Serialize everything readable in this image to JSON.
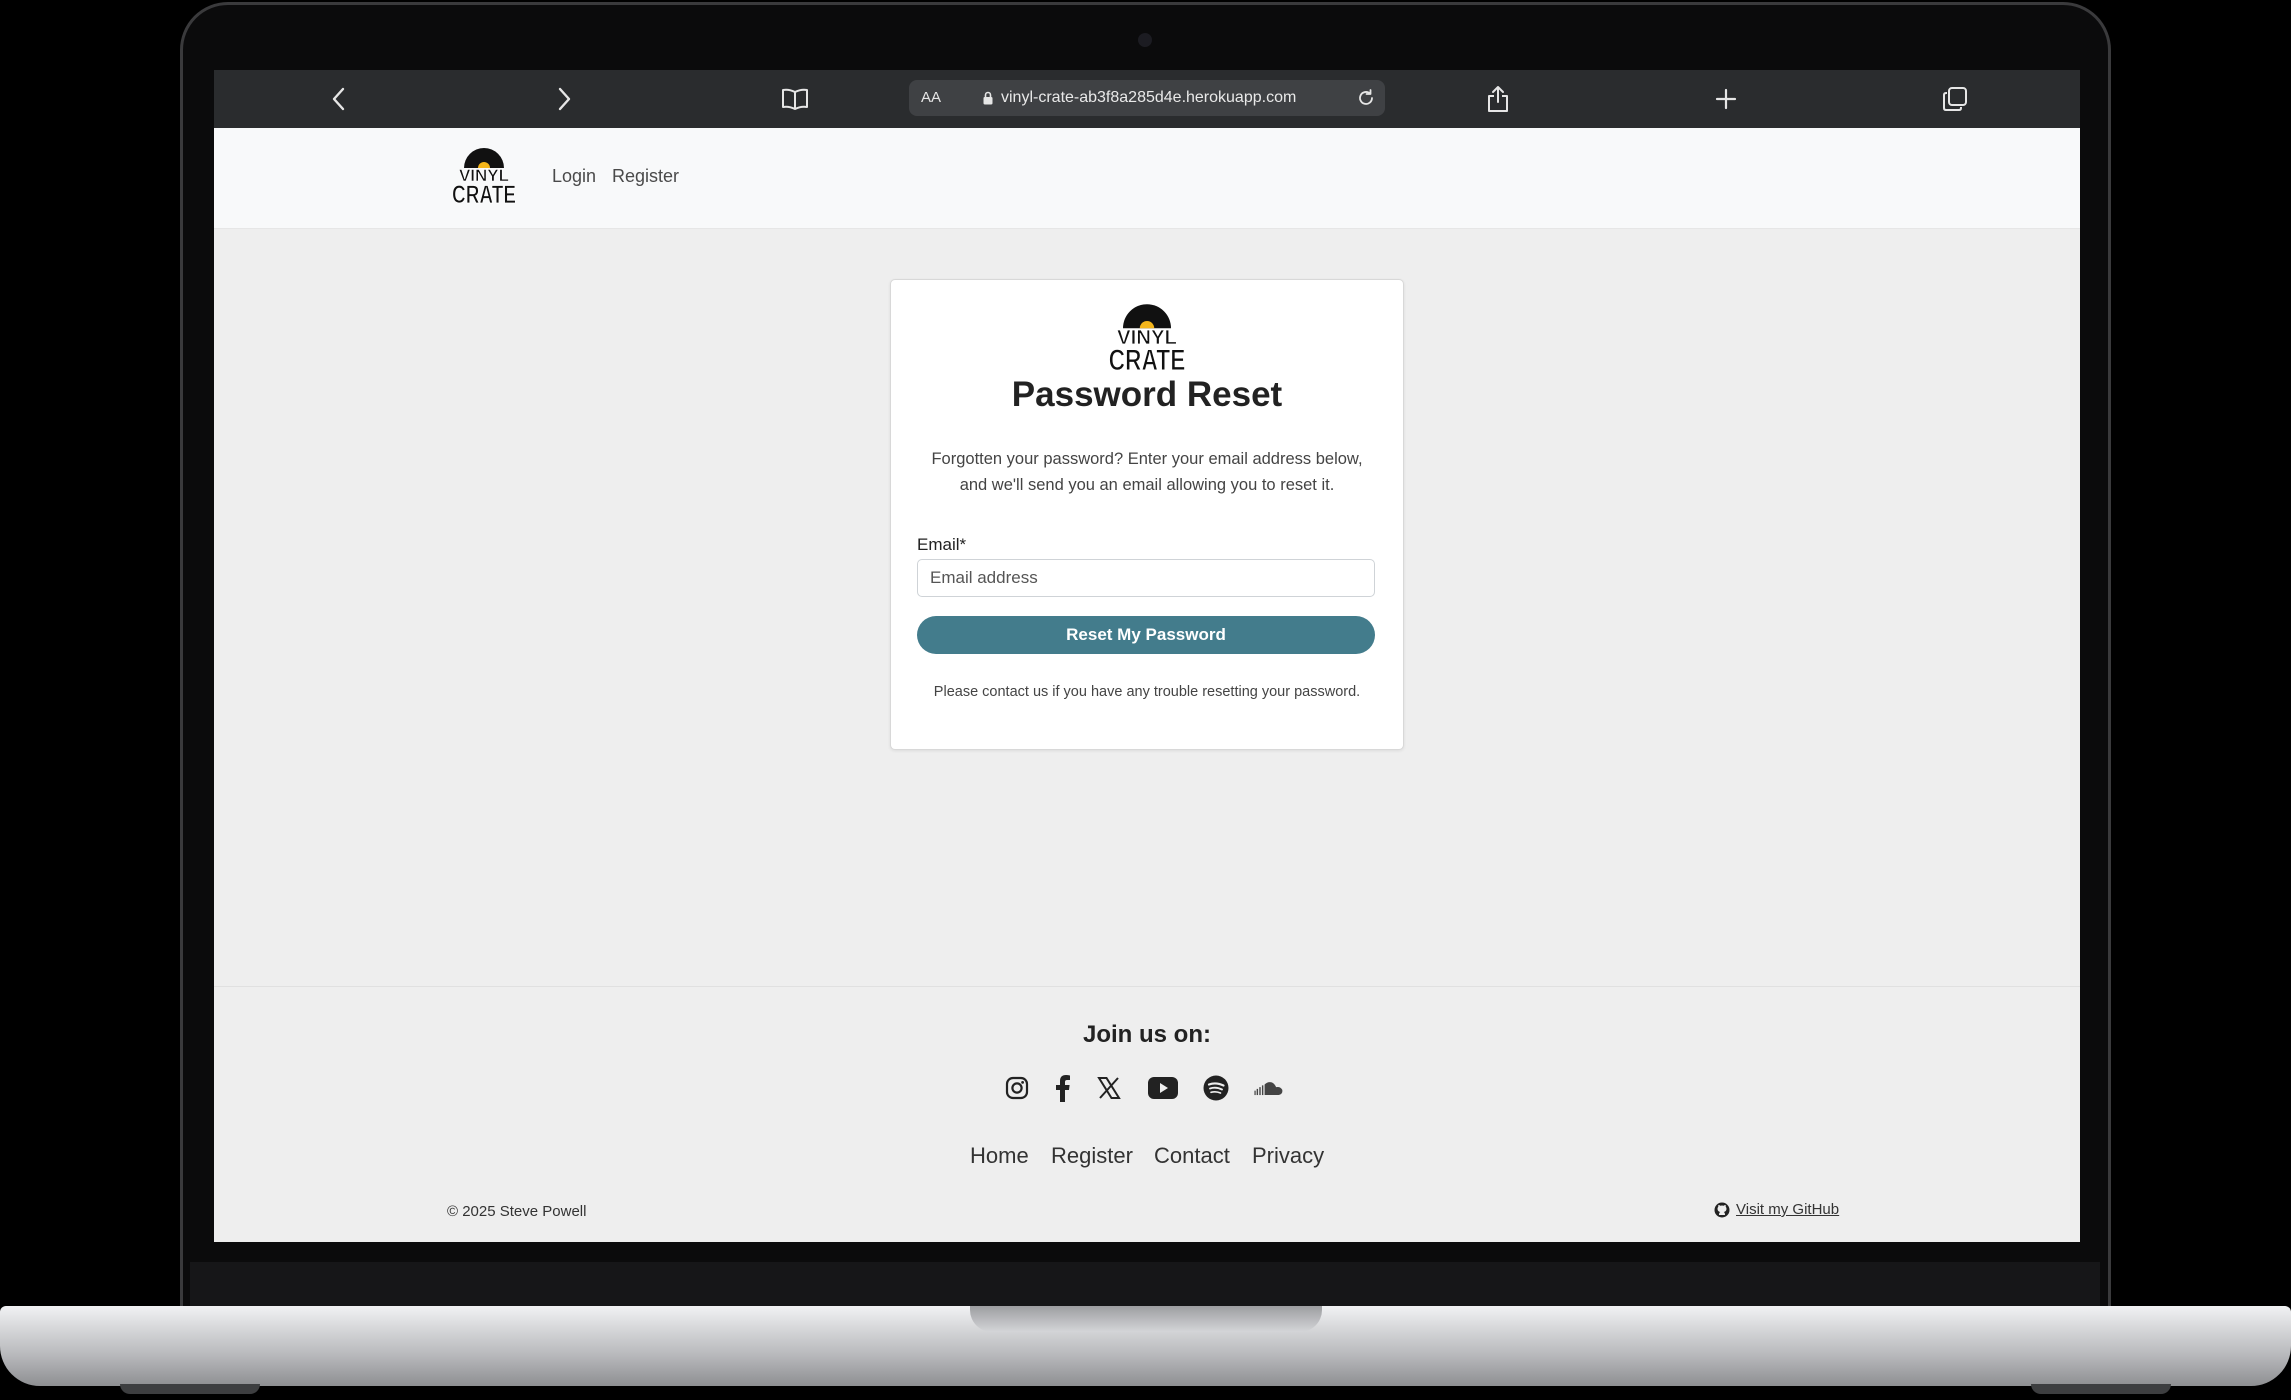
{
  "browser": {
    "url_prefix": "AA",
    "url": "vinyl-crate-ab3f8a285d4e.herokuapp.com",
    "icons": [
      "back-icon",
      "forward-icon",
      "bookmarks-icon",
      "lock-icon",
      "reload-icon",
      "share-icon",
      "new-tab-icon",
      "tabs-icon"
    ]
  },
  "header": {
    "logo_top": "VINYL",
    "logo_bottom": "CRATE",
    "nav": {
      "login": "Login",
      "register": "Register"
    }
  },
  "reset_card": {
    "logo_top": "VINYL",
    "logo_bottom": "CRATE",
    "title": "Password Reset",
    "intro_line1": "Forgotten your password? Enter your email address below,",
    "intro_line2": "and we'll send you an email allowing you to reset it.",
    "email_label": "Email*",
    "email_placeholder": "Email address",
    "email_value": "",
    "button_label": "Reset My Password",
    "help_text": "Please contact us if you have any trouble resetting your password."
  },
  "footer": {
    "join_label": "Join us on:",
    "social_icons": [
      "instagram-icon",
      "facebook-icon",
      "x-icon",
      "youtube-icon",
      "spotify-icon",
      "soundcloud-icon"
    ],
    "links": {
      "home": "Home",
      "register": "Register",
      "contact": "Contact",
      "privacy": "Privacy"
    },
    "copyright": "© 2025 Steve Powell",
    "github_label": "Visit my GitHub"
  },
  "colors": {
    "primary_button": "#437c8c",
    "page_background": "#eeeeee",
    "toolbar": "#2a2c2e"
  }
}
